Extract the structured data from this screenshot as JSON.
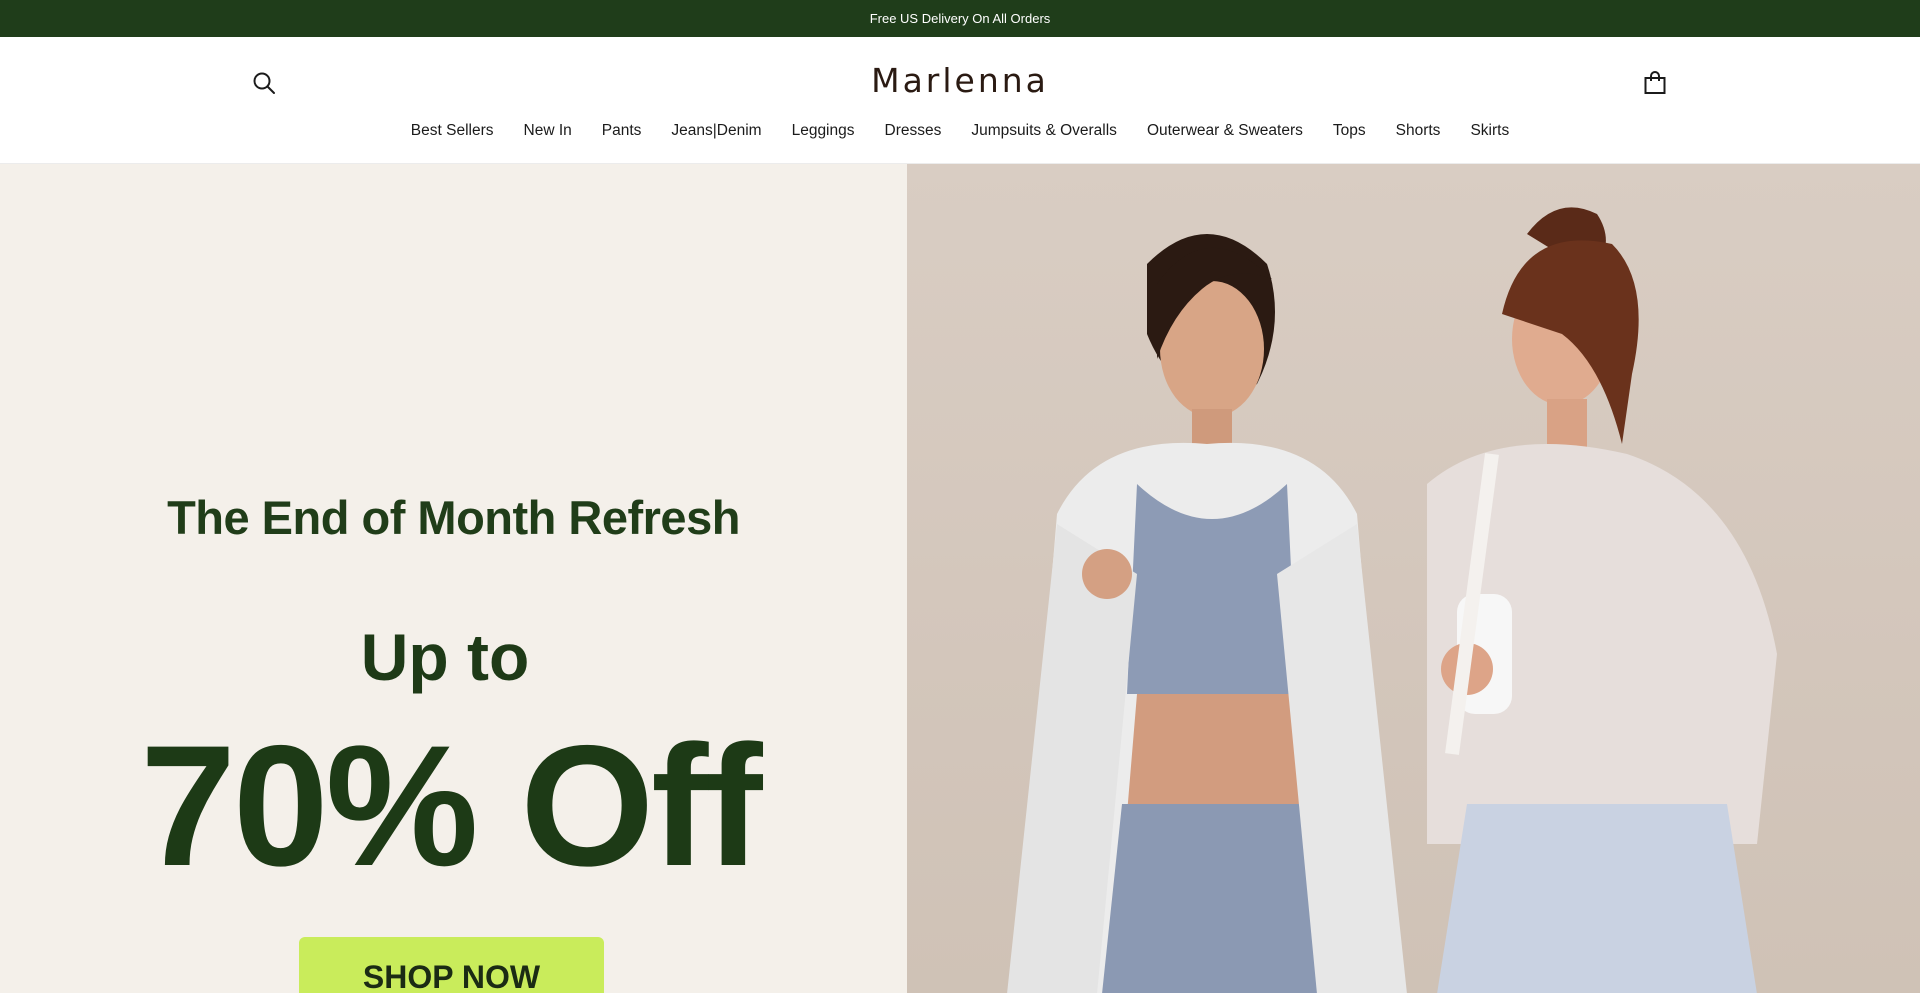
{
  "announcement": {
    "text": "Free US Delivery On All Orders"
  },
  "header": {
    "logo": "Marlenna",
    "icons": {
      "search": "search-icon",
      "cart": "shopping-bag-icon"
    }
  },
  "nav": {
    "items": [
      "Best Sellers",
      "New In",
      "Pants",
      "Jeans|Denim",
      "Leggings",
      "Dresses",
      "Jumpsuits & Overalls",
      "Outerwear & Sweaters",
      "Tops",
      "Shorts",
      "Skirts"
    ]
  },
  "hero": {
    "title": "The End of Month Refresh",
    "upto": "Up to",
    "discount": "70% Off",
    "cta": "SHOP NOW",
    "image_alt": "Two women in athleisure wear smiling at each other"
  },
  "colors": {
    "announcement_bg": "#1f3d1a",
    "headline": "#1d3a16",
    "cta_bg": "#c9ec5b",
    "hero_left_bg": "#f4f0ea"
  }
}
